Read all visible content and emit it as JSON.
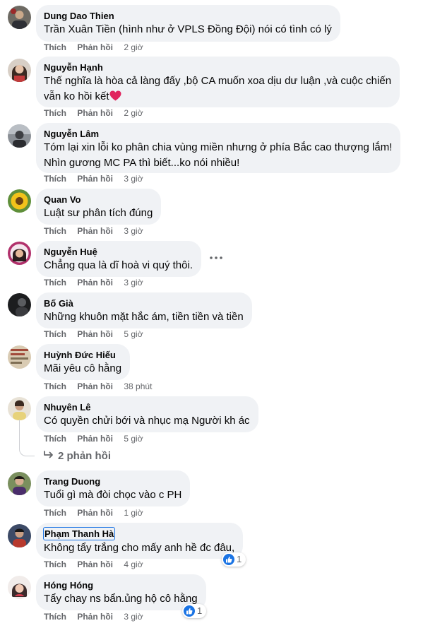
{
  "labels": {
    "like": "Thích",
    "reply": "Phản hồi"
  },
  "comments": [
    {
      "author": "Dung Dao Thien",
      "lines": [
        "Trần Xuân Tiền (hình như ở VPLS Đồng Đội) nói có tình có lý"
      ],
      "time": "2 giờ"
    },
    {
      "author": "Nguyễn Hạnh",
      "lines": [
        "Thế nghĩa là hòa cả làng đấy ,bộ CA muốn xoa dịu dư luận ,và cuộc chiến",
        "vẫn ko hồi kết"
      ],
      "time": "2 giờ"
    },
    {
      "author": "Nguyễn Lâm",
      "lines": [
        "Tóm lại xin lỗi ko phân chia vùng miền nhưng ở phía Bắc cao thượng lắm!",
        "Nhìn gương MC PA thì biết...ko nói nhiều!"
      ],
      "time": "3 giờ"
    },
    {
      "author": "Quan Vo",
      "lines": [
        "Luật sư phân tích đúng"
      ],
      "time": "3 giờ"
    },
    {
      "author": "Nguyễn Huệ",
      "lines": [
        "Chẳng qua là dĩ hoà vi quý thôi."
      ],
      "time": "3 giờ"
    },
    {
      "author": "Bố Già",
      "lines": [
        "Những khuôn mặt hắc ám, tiền tiền và tiền"
      ],
      "time": "5 giờ"
    },
    {
      "author": "Huỳnh Đức Hiếu",
      "lines": [
        "Mãi yêu cô hằng"
      ],
      "time": "38 phút"
    },
    {
      "author": "Nhuyên Lê",
      "lines": [
        "Có quyền chửi bới và nhục mạ Người kh ác"
      ],
      "time": "5 giờ"
    },
    {
      "author": "Trang Duong",
      "lines": [
        "Tuổi gì mà đòi chọc vào c PH"
      ],
      "time": "1 giờ"
    },
    {
      "author": "Phạm Thanh Hà",
      "lines": [
        "Không tẩy trắng cho mấy anh hề đc đâu,"
      ],
      "time": "4 giờ",
      "reactions": "1"
    },
    {
      "author": "Hóng Hóng",
      "lines": [
        "Tẩy chay ns bẩn.ủng hộ cô hằng"
      ],
      "time": "3 giờ",
      "reactions": "1"
    }
  ],
  "replies_link": "2 phản hồi",
  "icons": {
    "like": "like-icon",
    "heart": "heart-icon",
    "more": "more-options-icon",
    "reply_arrow": "reply-arrow-icon"
  },
  "colors": {
    "bubble": "#f0f2f5",
    "meta": "#65676b",
    "like_blue": "#1b74e4",
    "heart_red": "#f02849"
  }
}
